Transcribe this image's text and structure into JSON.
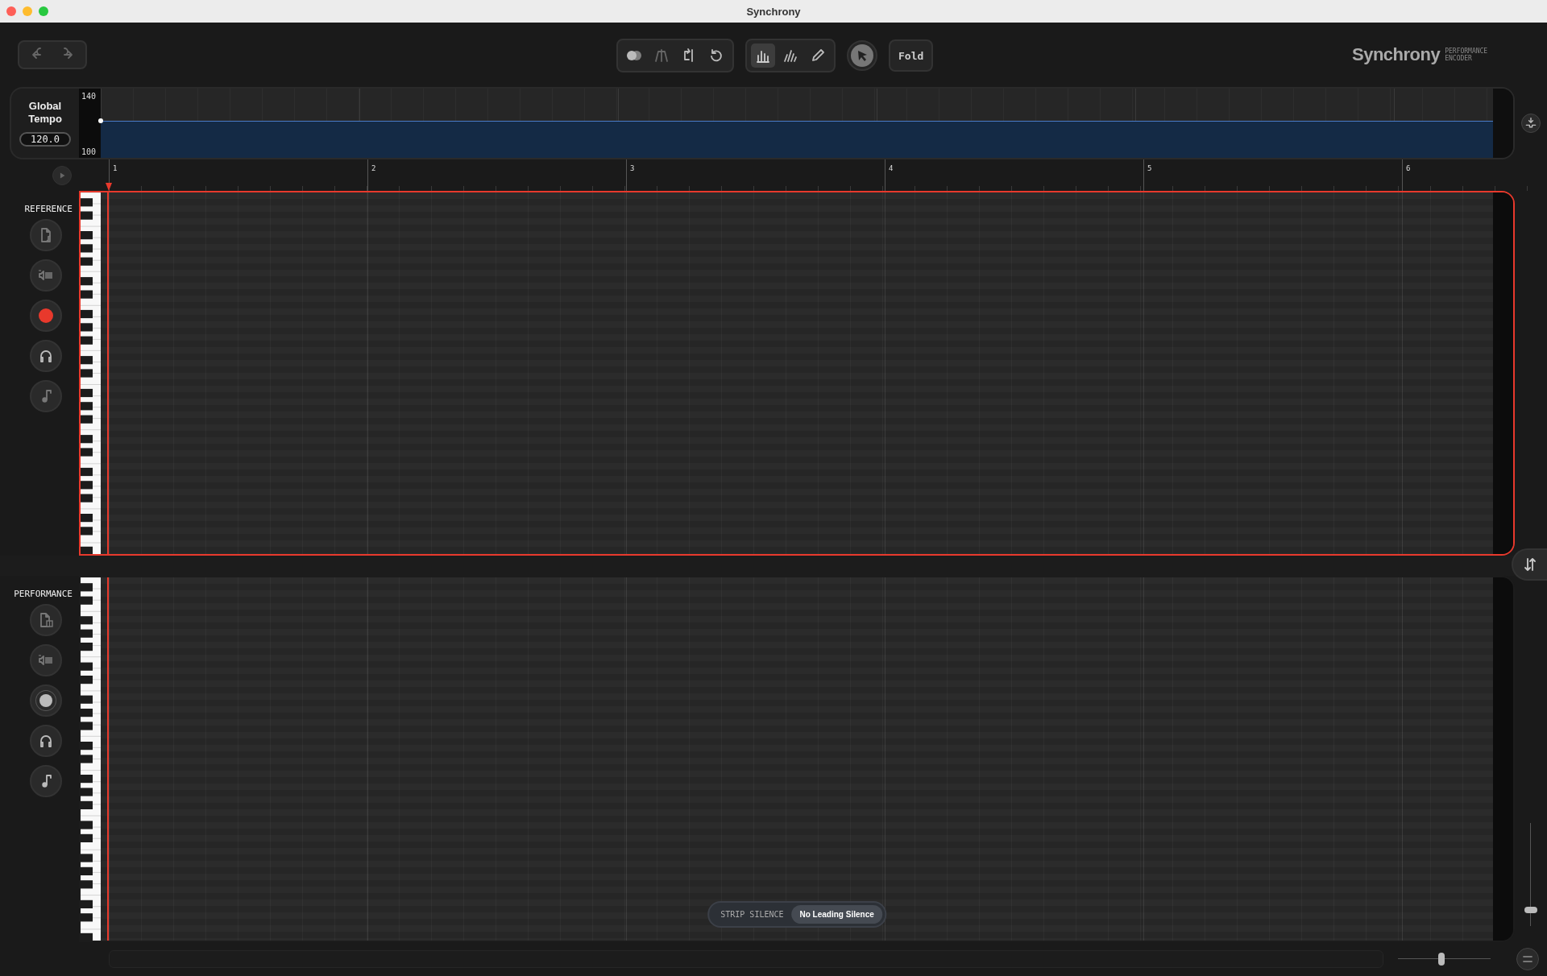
{
  "window": {
    "title": "Synchrony"
  },
  "history": [
    {
      "kind": "undo",
      "disabled": true
    },
    {
      "kind": "redo",
      "disabled": true
    }
  ],
  "view_tools": [
    {
      "kind": "overlay",
      "disabled": false
    },
    {
      "kind": "align",
      "disabled": true
    },
    {
      "kind": "loop",
      "disabled": false
    },
    {
      "kind": "reset",
      "disabled": false
    }
  ],
  "edit_tools": [
    {
      "kind": "bars",
      "selected": true
    },
    {
      "kind": "slant-bars",
      "selected": false
    },
    {
      "kind": "pencil",
      "selected": false
    }
  ],
  "pointer": {
    "selected": true
  },
  "fold_button": "Fold",
  "brand": {
    "name": "Synchrony",
    "tagline": [
      "PERFORMANCE",
      "ENCODER"
    ]
  },
  "tempo": {
    "label": "Global Tempo",
    "value": "120.0",
    "axis_max": "140",
    "axis_min": "100"
  },
  "ruler": {
    "bars": [
      "1",
      "2",
      "3",
      "4",
      "5",
      "6"
    ]
  },
  "tracks": [
    {
      "name": "REFERENCE",
      "selected": true,
      "kind": "audio",
      "record_armed": true
    },
    {
      "name": "PERFORMANCE",
      "selected": false,
      "kind": "midi",
      "record_armed": false
    }
  ],
  "strip_silence": {
    "label": "STRIP SILENCE",
    "options": [
      {
        "label": "No Leading Silence",
        "selected": true
      }
    ]
  },
  "zoom": {
    "vertical": {
      "level": 0.16
    },
    "horizontal": {
      "level": 0.47
    }
  }
}
